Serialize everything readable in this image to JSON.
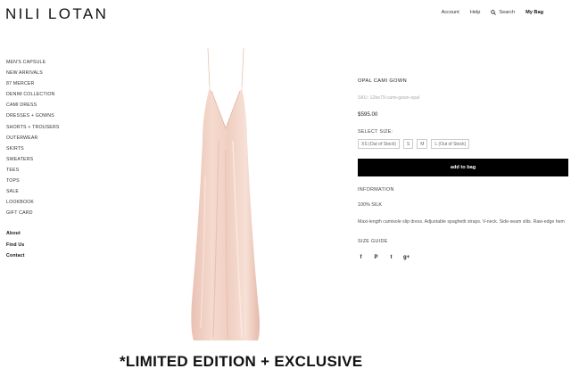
{
  "brand": {
    "logo": "NILI LOTAN"
  },
  "topnav": {
    "account": "Account",
    "help": "Help",
    "search": "Search",
    "bag": "My Bag"
  },
  "sidebar": {
    "categories": [
      "MEN'S CAPSULE",
      "NEW ARRIVALS",
      "87 MERCER",
      "DENIM COLLECTION",
      "CAMI DRESS",
      "DRESSES + GOWNS",
      "SHORTS + TROUSERS",
      "OUTERWEAR",
      "SKIRTS",
      "SWEATERS",
      "TEES",
      "TOPS",
      "SALE",
      "LOOKBOOK",
      "GIFT CARD"
    ],
    "links": [
      "About",
      "Find Us",
      "Contact"
    ]
  },
  "product": {
    "name": "OPAL CAMI GOWN",
    "sku": "SKU: 12be79-cami-gown-opal",
    "price": "$595.00",
    "select_size_label": "SELECT SIZE:",
    "sizes": [
      "XS (Out of Stock)",
      "S",
      "M",
      "L (Out of Stock)"
    ],
    "add_to_bag": "add to bag",
    "information_label": "INFORMATION",
    "material": "100% SILK",
    "description": "Maxi-length camisole slip dress. Adjustable spaghetti straps. V-neck. Side-seam slits. Raw-edge hem",
    "size_guide": "SIZE GUIDE",
    "social_icons": [
      "facebook-icon",
      "pinterest-icon",
      "twitter-icon",
      "google-plus-icon"
    ],
    "social_glyphs": [
      "f",
      "P",
      "t",
      "g+"
    ]
  },
  "caption": "*LIMITED EDITION + EXCLUSIVE",
  "colors": {
    "dress": "#f1d0c3",
    "button": "#000000"
  }
}
